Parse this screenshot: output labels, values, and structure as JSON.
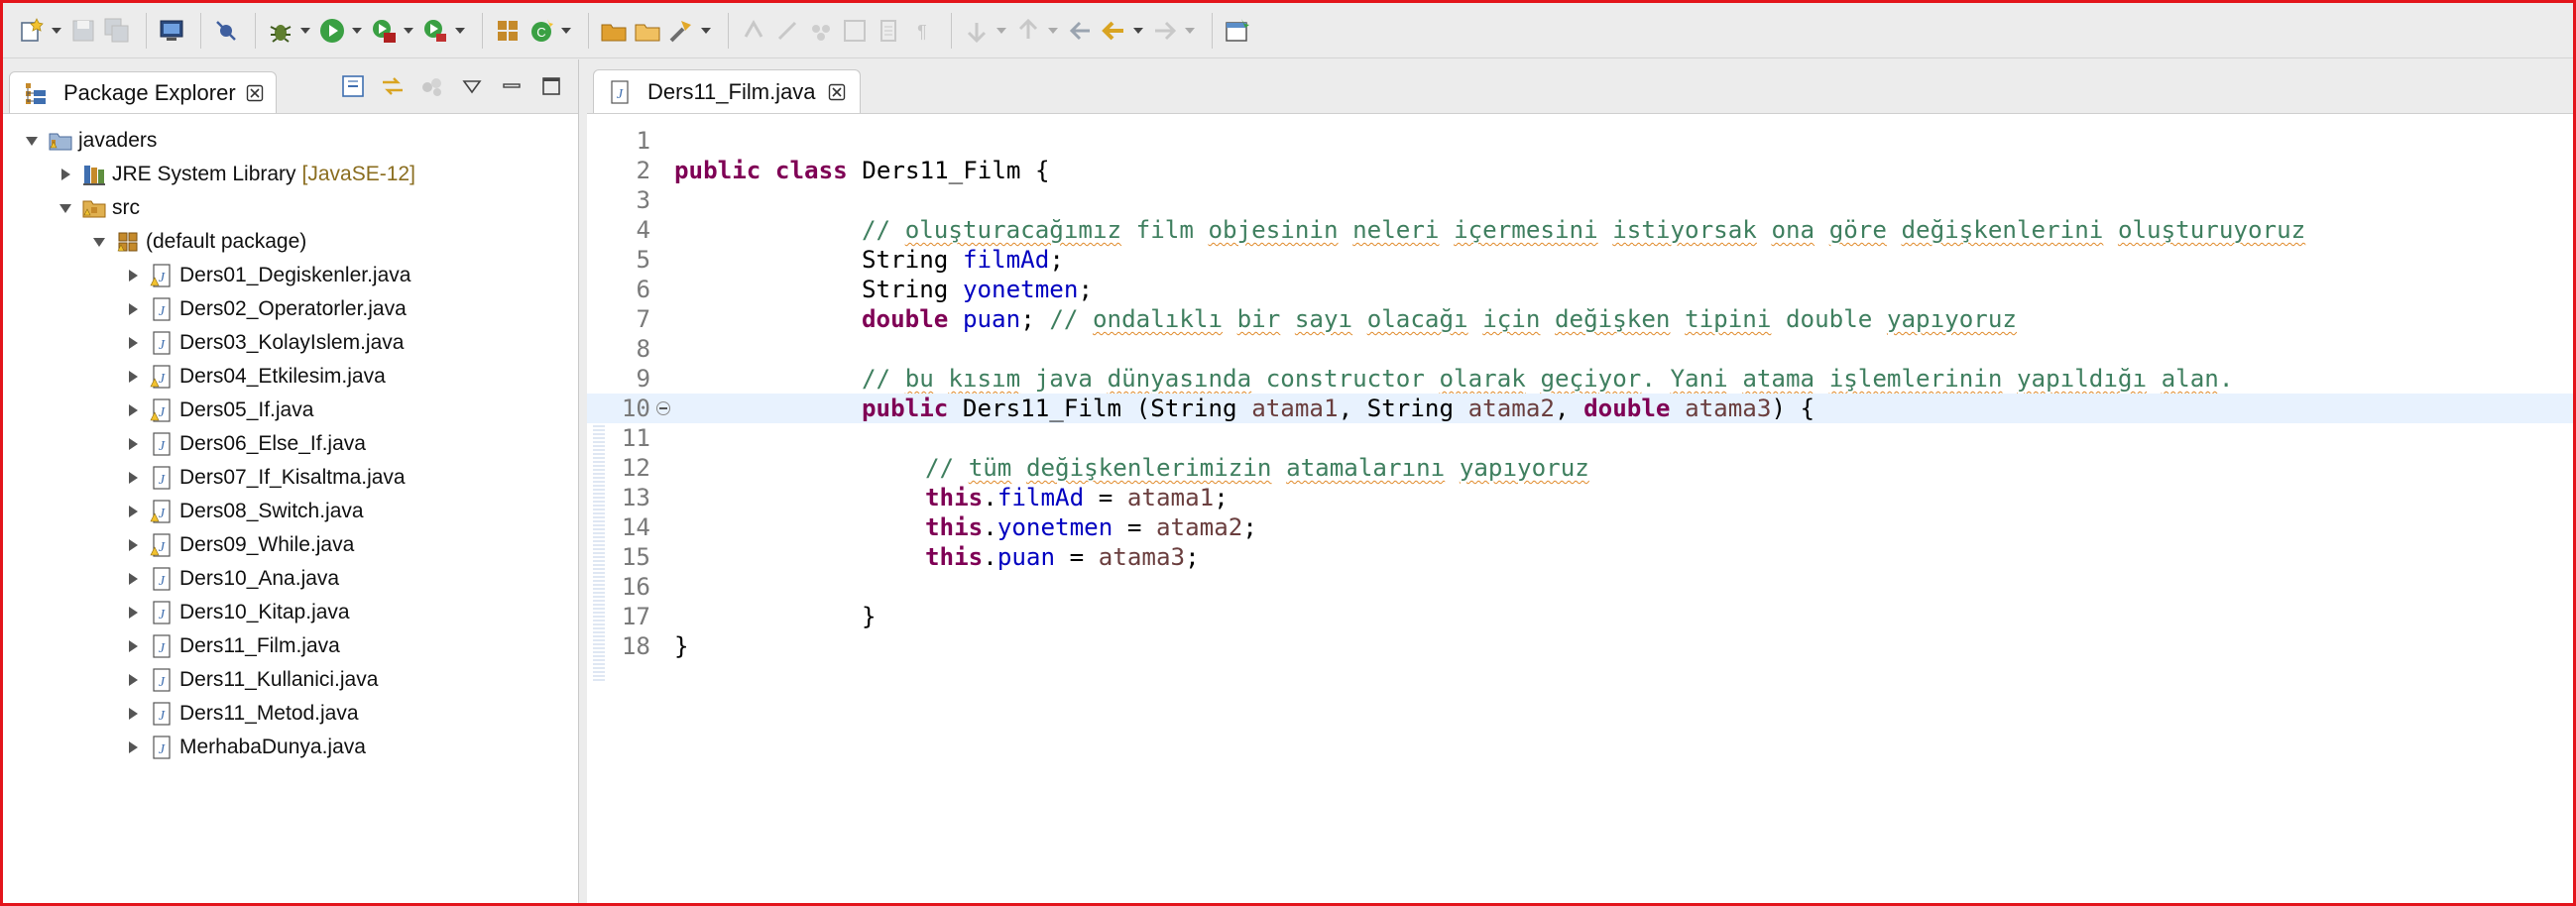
{
  "toolbar": {
    "buttons": [
      "new-icon",
      "save-icon",
      "save-all-icon",
      "terminal-icon",
      "skip-breakpoints-icon",
      "debug-icon",
      "run-icon",
      "coverage-icon",
      "external-tools-icon",
      "new-java-package-icon",
      "new-java-class-icon",
      "open-type-icon",
      "open-task-icon",
      "search-icon",
      "toggle-mark-occurrences-icon",
      "toggle-block-selection-icon",
      "show-whitespace-icon",
      "next-annotation-icon",
      "previous-annotation-icon",
      "last-edit-location-icon",
      "back-icon",
      "forward-icon",
      "perspective-icon"
    ]
  },
  "package_explorer": {
    "tab_label": "Package Explorer",
    "project": "javaders",
    "jre_label": "JRE System Library",
    "jre_version": "[JavaSE-12]",
    "src": "src",
    "default_package": "(default package)",
    "files": [
      {
        "name": "Ders01_Degiskenler.java",
        "warning": true
      },
      {
        "name": "Ders02_Operatorler.java",
        "warning": false
      },
      {
        "name": "Ders03_KolayIslem.java",
        "warning": false
      },
      {
        "name": "Ders04_Etkilesim.java",
        "warning": true
      },
      {
        "name": "Ders05_If.java",
        "warning": true
      },
      {
        "name": "Ders06_Else_If.java",
        "warning": false
      },
      {
        "name": "Ders07_If_Kisaltma.java",
        "warning": false
      },
      {
        "name": "Ders08_Switch.java",
        "warning": true
      },
      {
        "name": "Ders09_While.java",
        "warning": true
      },
      {
        "name": "Ders10_Ana.java",
        "warning": false
      },
      {
        "name": "Ders10_Kitap.java",
        "warning": false
      },
      {
        "name": "Ders11_Film.java",
        "warning": false
      },
      {
        "name": "Ders11_Kullanici.java",
        "warning": false
      },
      {
        "name": "Ders11_Metod.java",
        "warning": false
      },
      {
        "name": "MerhabaDunya.java",
        "warning": false
      }
    ]
  },
  "editor": {
    "tab_label": "Ders11_Film.java",
    "current_line": 10,
    "code": {
      "l2_kw": "public class",
      "l2_rest": " Ders11_Film {",
      "l4_c1": "// ",
      "l4_c2": "oluşturacağımız",
      "l4_c3": " film ",
      "l4_c4": "objesinin",
      "l4_c5": " ",
      "l4_c6": "neleri",
      "l4_c7": " ",
      "l4_c8": "içermesini",
      "l4_c9": " ",
      "l4_c10": "istiyorsak",
      "l4_c11": " ",
      "l4_c12": "ona",
      "l4_c13": " ",
      "l4_c14": "göre",
      "l4_c15": " ",
      "l4_c16": "değişkenlerini",
      "l4_c17": " ",
      "l4_c18": "oluşturuyoruz",
      "l5_type": "String ",
      "l5_field": "filmAd",
      "l5_end": ";",
      "l6_type": "String ",
      "l6_field": "yonetmen",
      "l6_end": ";",
      "l7_kw": "double",
      "l7_sp": " ",
      "l7_field": "puan",
      "l7_semi": "; ",
      "l7_c1": "// ",
      "l7_c2": "ondalıklı",
      "l7_c3": " ",
      "l7_c4": "bir",
      "l7_c5": " ",
      "l7_c6": "sayı",
      "l7_c7": " ",
      "l7_c8": "olacağı",
      "l7_c9": " ",
      "l7_c10": "için",
      "l7_c11": " ",
      "l7_c12": "değişken",
      "l7_c13": " ",
      "l7_c14": "tipini",
      "l7_c15": " double ",
      "l7_c16": "yapıyoruz",
      "l9_c1": "// ",
      "l9_c2": "bu",
      "l9_c3": " ",
      "l9_c4": "kısım",
      "l9_c5": " java ",
      "l9_c6": "dünyasında",
      "l9_c7": " constructor ",
      "l9_c8": "olarak",
      "l9_c9": " ",
      "l9_c10": "geçiyor",
      "l9_c11": ". ",
      "l9_c12": "Yani",
      "l9_c13": " ",
      "l9_c14": "atama",
      "l9_c15": " ",
      "l9_c16": "işlemlerinin",
      "l9_c17": " ",
      "l9_c18": "yapıldığı",
      "l9_c19": " ",
      "l9_c20": "alan",
      "l9_c21": ".",
      "l10_kw1": "public",
      "l10_a": " Ders11_Film (String ",
      "l10_p1": "atama1",
      "l10_b": ", String ",
      "l10_p2": "atama2",
      "l10_c": ", ",
      "l10_kw2": "double",
      "l10_d": " ",
      "l10_p3": "atama3",
      "l10_e": ") {",
      "l12_c1": "// ",
      "l12_c2": "tüm",
      "l12_c3": " ",
      "l12_c4": "değişkenlerimizin",
      "l12_c5": " ",
      "l12_c6": "atamalarını",
      "l12_c7": " ",
      "l12_c8": "yapıyoruz",
      "l13_kw": "this",
      "l13_dot": ".",
      "l13_field": "filmAd",
      "l13_eq": " = ",
      "l13_p": "atama1",
      "l13_end": ";",
      "l14_kw": "this",
      "l14_dot": ".",
      "l14_field": "yonetmen",
      "l14_eq": " = ",
      "l14_p": "atama2",
      "l14_end": ";",
      "l15_kw": "this",
      "l15_dot": ".",
      "l15_field": "puan",
      "l15_eq": " = ",
      "l15_p": "atama3",
      "l15_end": ";",
      "l17": "}",
      "l18": "}"
    }
  }
}
